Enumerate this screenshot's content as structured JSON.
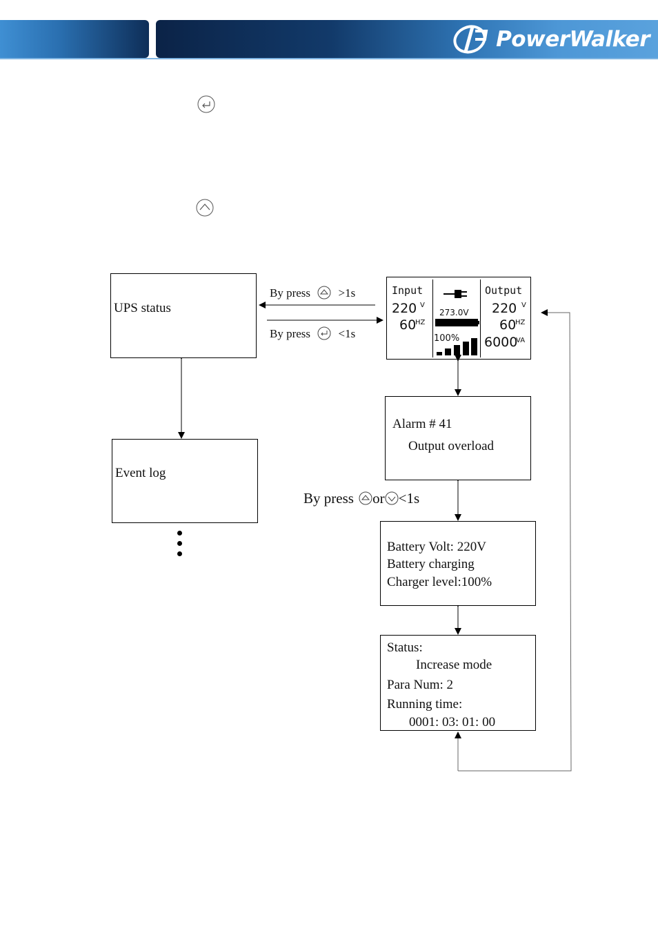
{
  "header": {
    "brand": "PowerWalker",
    "colors": {
      "band_dark": "#0b2347",
      "band_light": "#4d97d6",
      "underline": "#7fb5e3"
    }
  },
  "icons": {
    "enter_button": "enter-key-icon",
    "up_button": "up-arrow-button-icon"
  },
  "diagram": {
    "ups_status": {
      "label": "UPS status"
    },
    "event_log": {
      "label": "Event log"
    },
    "more_indicator": "⋮",
    "transition_up": {
      "prefix": "By press",
      "suffix": ">1s",
      "icon": "up-button-icon"
    },
    "transition_enter": {
      "prefix": "By press",
      "suffix": "<1s",
      "icon": "enter-button-icon"
    },
    "scroll_hint": {
      "prefix": "By press",
      "middle": "or",
      "suffix": "<1s",
      "icons": [
        "up-button-icon",
        "down-button-icon"
      ]
    },
    "lcd": {
      "input_label": "Input",
      "input_voltage": "220",
      "input_voltage_unit": "V",
      "input_freq": "60",
      "input_freq_unit": "HZ",
      "battery_voltage": "273.0V",
      "load_percent": "100%",
      "output_label": "Output",
      "output_voltage": "220",
      "output_voltage_unit": "V",
      "output_freq": "60",
      "output_freq_unit": "HZ",
      "output_power": "6000",
      "output_power_unit": "VA",
      "battery_level_fraction": 1.0,
      "load_bars": 5
    },
    "alarm": {
      "line1": "Alarm # 41",
      "line2": "Output overload"
    },
    "battery": {
      "line1": "Battery Volt:  220V",
      "line2": "Battery charging",
      "line3": "Charger level:100%"
    },
    "status": {
      "line1": "Status:",
      "line2": "Increase mode",
      "line3": "Para Num:   2",
      "line4": "Running time:",
      "line5": "0001: 03: 01: 00"
    }
  }
}
